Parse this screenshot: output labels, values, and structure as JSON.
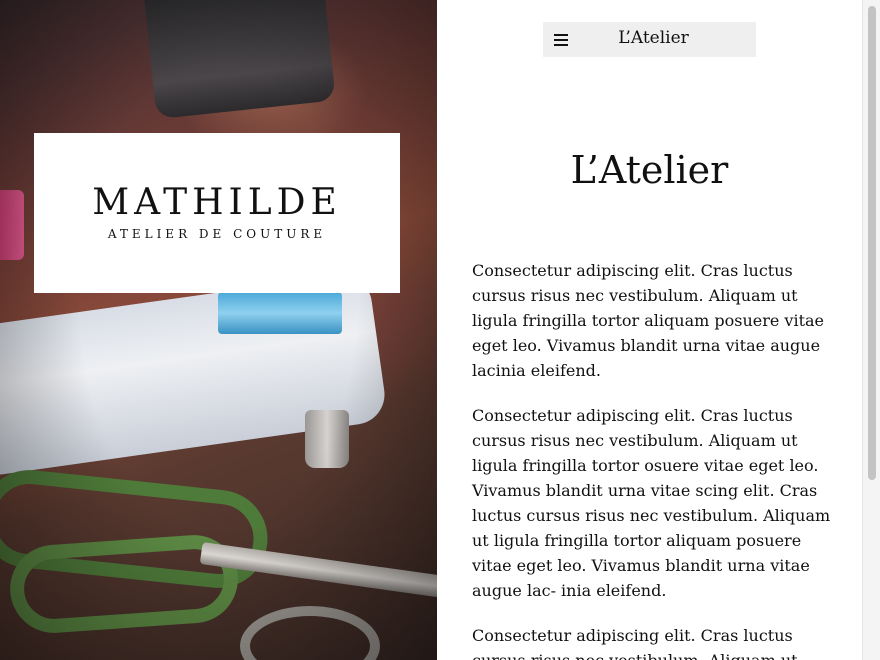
{
  "logo": {
    "name": "MATHILDE",
    "subtitle": "ATELIER DE COUTURE"
  },
  "header": {
    "title": "L’Atelier",
    "menu_icon": "hamburger-menu-icon"
  },
  "page": {
    "title": "L’Atelier"
  },
  "paragraphs": [
    "Consectetur adipiscing elit. Cras luctus cursus risus nec vestibulum. Aliquam ut ligula fringilla tortor aliquam posuere vitae eget leo. Vivamus blandit urna vitae augue lacinia eleifend.",
    "Consectetur adipiscing elit. Cras luctus cursus risus nec vestibulum. Aliquam ut ligula fringilla tortor osuere vitae eget leo. Vivamus blandit urna vitae scing elit. Cras luctus cursus risus nec vestibulum. Aliquam ut ligula fringilla tortor aliquam posuere vitae eget leo. Vivamus blandit urna vitae augue lac- inia eleifend.",
    "Consectetur adipiscing elit. Cras luctus cursus risus nec vestibulum. Aliquam ut"
  ],
  "colors": {
    "background": "#ffffff",
    "topbar": "#efefef",
    "text": "#111111"
  }
}
